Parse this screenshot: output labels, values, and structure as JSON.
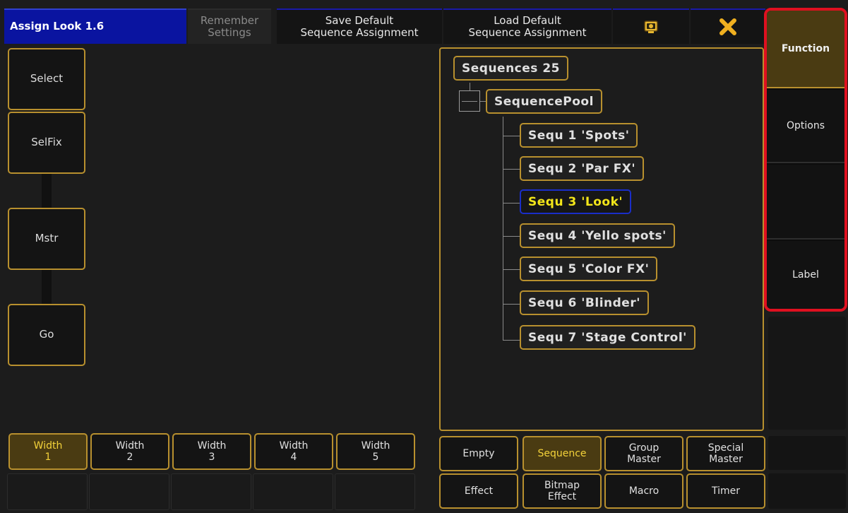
{
  "title": "Assign Look 1.6",
  "top_buttons": {
    "remember": "Remember\nSettings",
    "save_default": "Save Default\nSequence Assignment",
    "load_default": "Load Default\nSequence Assignment"
  },
  "icons": {
    "camera": "camera-icon",
    "close": "close-icon"
  },
  "left_buttons": [
    "Select",
    "SelFix",
    "Mstr",
    "Go"
  ],
  "tree": {
    "root": "Sequences 25",
    "pool": "SequencePool",
    "items": [
      "Sequ 1 'Spots'",
      "Sequ 2 'Par FX'",
      "Sequ 3 'Look'",
      "Sequ 4 'Yello spots'",
      "Sequ 5 'Color FX'",
      "Sequ 6 'Blinder'",
      "Sequ 7 'Stage Control'"
    ],
    "selected_index": 2
  },
  "side_menu": {
    "function": "Function",
    "options": "Options",
    "empty": "",
    "label": "Label"
  },
  "width_buttons": [
    "Width\n1",
    "Width\n2",
    "Width\n3",
    "Width\n4",
    "Width\n5"
  ],
  "type_buttons": {
    "row1": [
      "Empty",
      "Sequence",
      "Group\nMaster",
      "Special\nMaster"
    ],
    "row2": [
      "Effect",
      "Bitmap\nEffect",
      "Macro",
      "Timer"
    ]
  },
  "colors": {
    "accent_gold": "#b8902e",
    "title_blue": "#0a14a0",
    "selected_text": "#f3e61a",
    "side_border": "#e01020"
  }
}
